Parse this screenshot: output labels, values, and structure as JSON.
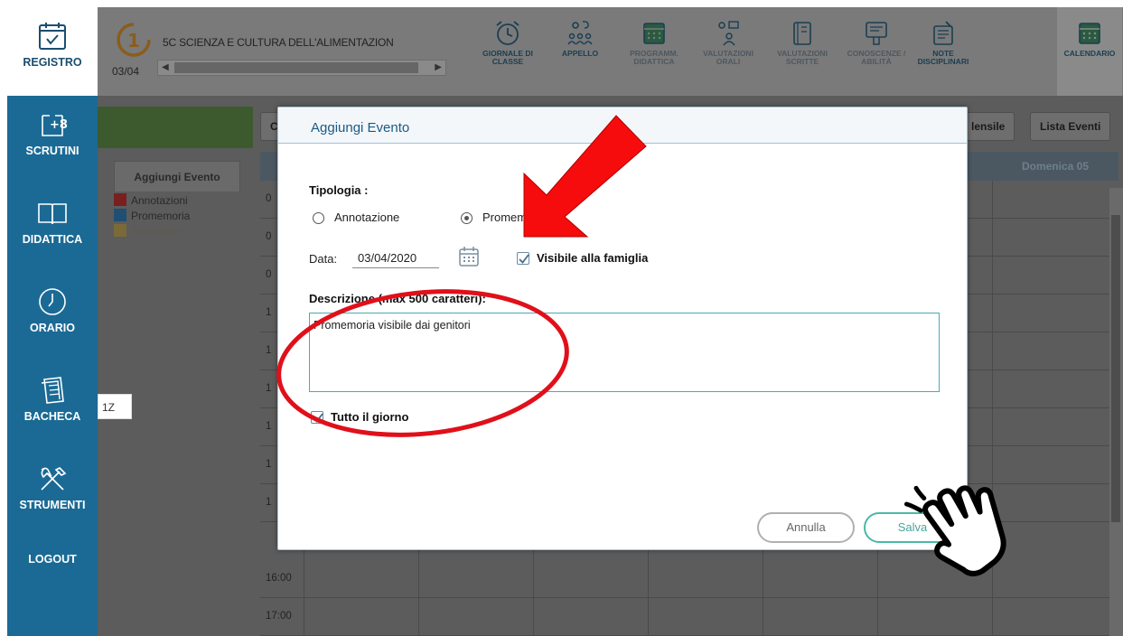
{
  "sidebar": {
    "items": [
      {
        "label": "REGISTRO",
        "icon": "calendar-check-icon"
      },
      {
        "label": "SCRUTINI",
        "icon": "scrutini-icon"
      },
      {
        "label": "DIDATTICA",
        "icon": "book-icon"
      },
      {
        "label": "ORARIO",
        "icon": "clock-icon"
      },
      {
        "label": "BACHECA",
        "icon": "notice-board-icon"
      },
      {
        "label": "STRUMENTI",
        "icon": "tools-icon"
      },
      {
        "label": "LOGOUT",
        "icon": ""
      }
    ]
  },
  "header": {
    "course_title": "5C SCIENZA E CULTURA DELL'ALIMENTAZION",
    "course_date": "03/04",
    "tools": [
      {
        "label_1": "GIORNALE DI",
        "label_2": "CLASSE",
        "icon": "alarm-clock-icon"
      },
      {
        "label_1": "APPELLO",
        "label_2": "",
        "icon": "people-icon"
      },
      {
        "label_1": "PROGRAMM.",
        "label_2": "DIDATTICA",
        "icon": "calendar-grid-icon"
      },
      {
        "label_1": "VALUTAZIONI",
        "label_2": "ORALI",
        "icon": "oral-eval-icon"
      },
      {
        "label_1": "VALUTAZIONI",
        "label_2": "SCRITTE",
        "icon": "written-eval-icon"
      },
      {
        "label_1": "CONOSCENZE /",
        "label_2": "ABILITÀ",
        "icon": "skills-icon"
      },
      {
        "label_1": "NOTE",
        "label_2": "DISCIPLINARI",
        "icon": "notes-icon"
      },
      {
        "label_1": "CALENDARIO",
        "label_2": "",
        "icon": "calendar-icon"
      }
    ]
  },
  "toolbar": {
    "tab_c": "C",
    "tab_mensile": "lensile",
    "tab_lista_eventi": "Lista Eventi"
  },
  "left_panel": {
    "add_event_tab": "Aggiungi Evento",
    "legend": [
      {
        "label": "Annotazioni",
        "color": "#7a1f1f"
      },
      {
        "label": "Promemoria",
        "color": "#1f4f73"
      },
      {
        "label": "Personale",
        "color": "#7a6a3a"
      }
    ]
  },
  "calendar": {
    "day_header": "Domenica 05",
    "times": [
      "0",
      "0",
      "0",
      "1",
      "1",
      "1",
      "1",
      "1",
      "1",
      "16:00",
      "17:00"
    ]
  },
  "tag": "1Z",
  "modal": {
    "title": "Aggiungi Evento",
    "tipologia_label": "Tipologia :",
    "option_annotazione": "Annotazione",
    "option_promemoria": "Promemo",
    "data_label": "Data:",
    "data_value": "03/04/2020",
    "visibile_label": "Visibile alla famiglia",
    "descrizione_label": "Descrizione (max 500 caratteri):",
    "descrizione_value": "Promemoria visibile dai genitori",
    "tutto_giorno_label": "Tutto il giorno",
    "annulla_label": "Annulla",
    "salva_label": "Salva"
  }
}
